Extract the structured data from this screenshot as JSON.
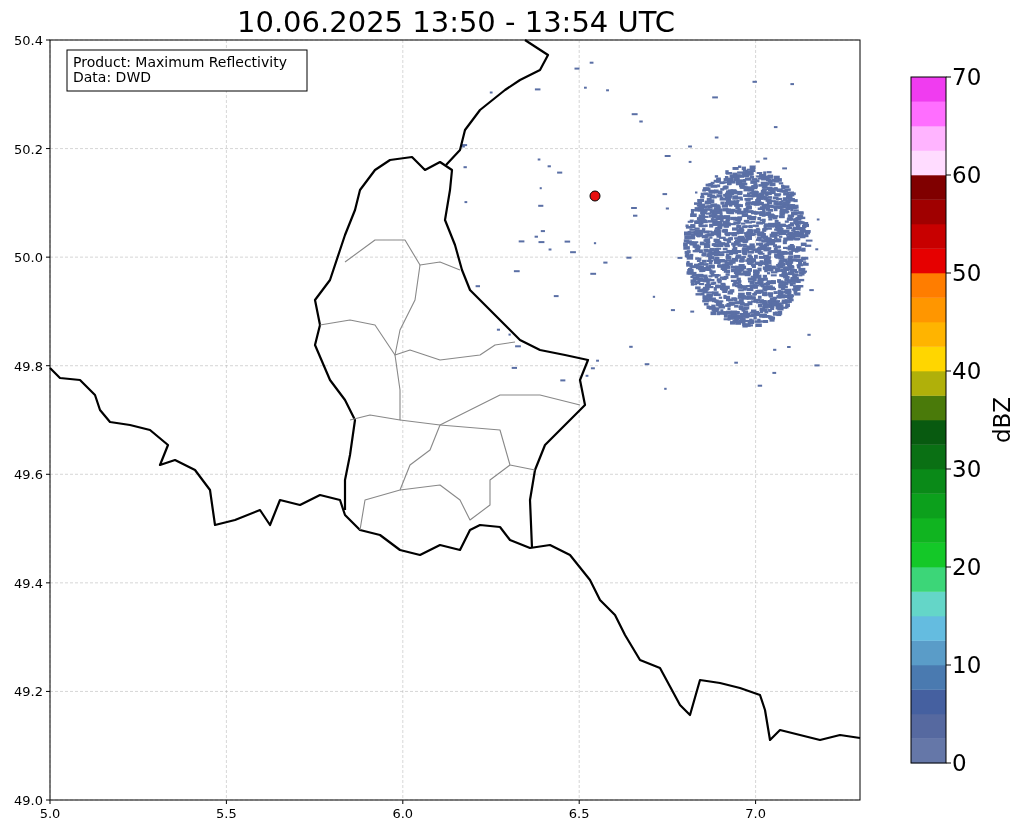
{
  "title": "10.06.2025 13:50 - 13:54 UTC",
  "info_box": {
    "lines": [
      "Product: Maximum Reflectivity",
      "Data: DWD"
    ]
  },
  "map": {
    "x_ticks": [
      "5.0",
      "5.5",
      "6.0",
      "6.5",
      "7.0"
    ],
    "y_ticks": [
      "50.4",
      "50.2",
      "50.0",
      "49.8",
      "49.6",
      "49.4",
      "49.2",
      "49.0"
    ]
  },
  "colorbar": {
    "label": "dBZ",
    "ticks": [
      "70",
      "60",
      "50",
      "40",
      "30",
      "20",
      "10",
      "0"
    ],
    "segments": [
      {
        "color": "#6577a8"
      },
      {
        "color": "#5669a0"
      },
      {
        "color": "#4560a0"
      },
      {
        "color": "#4a7ab0"
      },
      {
        "color": "#5a9cc8"
      },
      {
        "color": "#64bce0"
      },
      {
        "color": "#64d6c8"
      },
      {
        "color": "#3cd678"
      },
      {
        "color": "#14c828"
      },
      {
        "color": "#10b420"
      },
      {
        "color": "#0ca01c"
      },
      {
        "color": "#0a8a18"
      },
      {
        "color": "#0a7014"
      },
      {
        "color": "#085a10"
      },
      {
        "color": "#4a7a0a"
      },
      {
        "color": "#b0b00a"
      },
      {
        "color": "#ffd600"
      },
      {
        "color": "#ffb400"
      },
      {
        "color": "#ff9600"
      },
      {
        "color": "#ff7d00"
      },
      {
        "color": "#e60000"
      },
      {
        "color": "#c80000"
      },
      {
        "color": "#a00000"
      },
      {
        "color": "#800000"
      },
      {
        "color": "#ffdcff"
      },
      {
        "color": "#ffb4ff"
      },
      {
        "color": "#ff6eff"
      },
      {
        "color": "#f03cf0"
      }
    ]
  }
}
